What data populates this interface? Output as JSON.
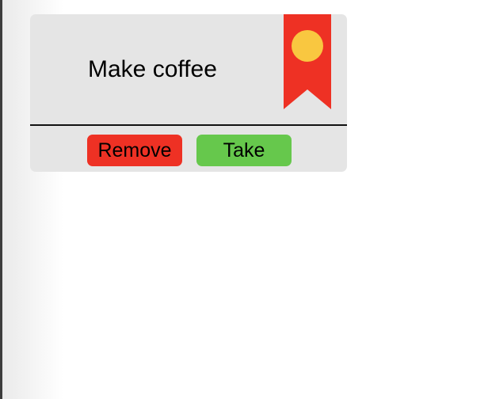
{
  "task_card": {
    "title": "Make coffee",
    "remove_label": "Remove",
    "take_label": "Take"
  },
  "colors": {
    "card_background": "#e5e5e5",
    "ribbon": "#ee3124",
    "ribbon_dot": "#f9c740",
    "remove_button": "#ee3124",
    "take_button": "#66c84c"
  },
  "icons": {
    "ribbon": "bookmark-ribbon-icon"
  }
}
